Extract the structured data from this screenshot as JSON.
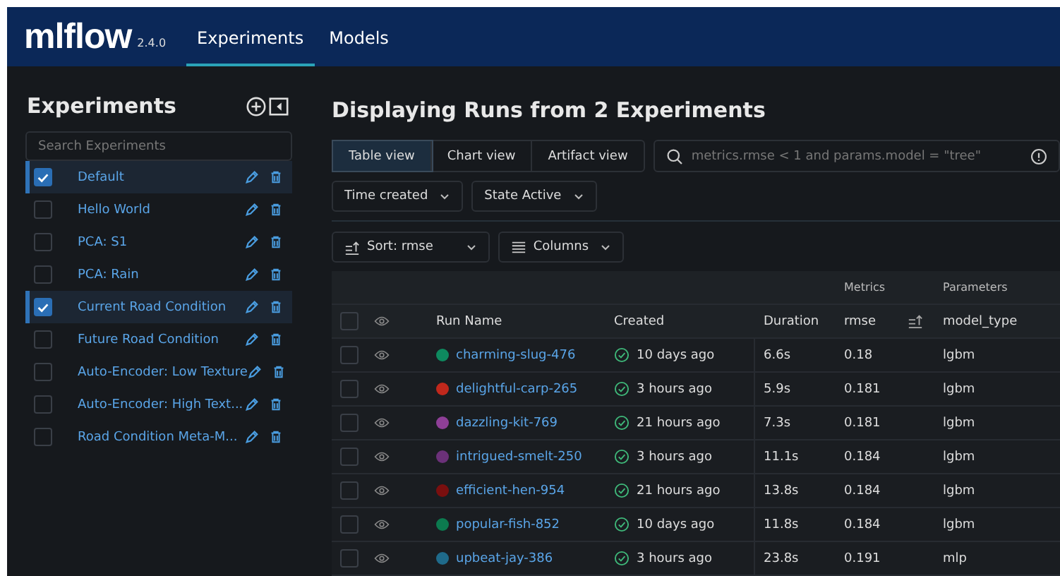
{
  "header": {
    "logo": "mlflow",
    "version": "2.4.0",
    "tabs": [
      {
        "label": "Experiments",
        "selected": true
      },
      {
        "label": "Models",
        "selected": false
      }
    ]
  },
  "sidebar": {
    "title": "Experiments",
    "search": {
      "placeholder": "Search Experiments"
    },
    "items": [
      {
        "name": "Default",
        "checked": true
      },
      {
        "name": "Hello World",
        "checked": false
      },
      {
        "name": "PCA: S1",
        "checked": false
      },
      {
        "name": "PCA: Rain",
        "checked": false
      },
      {
        "name": "Current Road Condition",
        "checked": true
      },
      {
        "name": "Future Road Condition",
        "checked": false
      },
      {
        "name": "Auto-Encoder: Low Texture",
        "checked": false
      },
      {
        "name": "Auto-Encoder: High Text...",
        "checked": false
      },
      {
        "name": "Road Condition Meta-M...",
        "checked": false
      }
    ]
  },
  "main": {
    "title": "Displaying Runs from 2 Experiments",
    "views": [
      {
        "label": "Table view",
        "selected": true
      },
      {
        "label": "Chart view",
        "selected": false
      },
      {
        "label": "Artifact view",
        "selected": false
      }
    ],
    "search": {
      "placeholder": "metrics.rmse < 1 and params.model = \"tree\""
    },
    "filters": [
      "Time created",
      "State Active"
    ],
    "sort": "Sort: rmse",
    "columns_button": "Columns",
    "table": {
      "select_all": {
        "checked": false
      },
      "groups": [
        "Metrics",
        "Parameters"
      ],
      "columns": [
        "Run Name",
        "Created",
        "Duration",
        "rmse",
        "model_type"
      ],
      "rows": [
        {
          "name": "charming-slug-476",
          "checked": false,
          "color": "#0e8a5f",
          "created": "10 days ago",
          "duration": "6.6s",
          "rmse": "0.18",
          "model_type": "lgbm"
        },
        {
          "name": "delightful-carp-265",
          "checked": false,
          "color": "#c0281c",
          "created": "3 hours ago",
          "duration": "5.9s",
          "rmse": "0.181",
          "model_type": "lgbm"
        },
        {
          "name": "dazzling-kit-769",
          "checked": false,
          "color": "#8e3f97",
          "created": "21 hours ago",
          "duration": "7.3s",
          "rmse": "0.181",
          "model_type": "lgbm"
        },
        {
          "name": "intrigued-smelt-250",
          "checked": false,
          "color": "#6b3179",
          "created": "3 hours ago",
          "duration": "11.1s",
          "rmse": "0.184",
          "model_type": "lgbm"
        },
        {
          "name": "efficient-hen-954",
          "checked": false,
          "color": "#7a0f0f",
          "created": "21 hours ago",
          "duration": "13.8s",
          "rmse": "0.184",
          "model_type": "lgbm"
        },
        {
          "name": "popular-fish-852",
          "checked": false,
          "color": "#0c7a4f",
          "created": "10 days ago",
          "duration": "11.8s",
          "rmse": "0.184",
          "model_type": "lgbm"
        },
        {
          "name": "upbeat-jay-386",
          "checked": false,
          "color": "#1f6a8a",
          "created": "3 hours ago",
          "duration": "23.8s",
          "rmse": "0.191",
          "model_type": "mlp"
        }
      ]
    }
  }
}
